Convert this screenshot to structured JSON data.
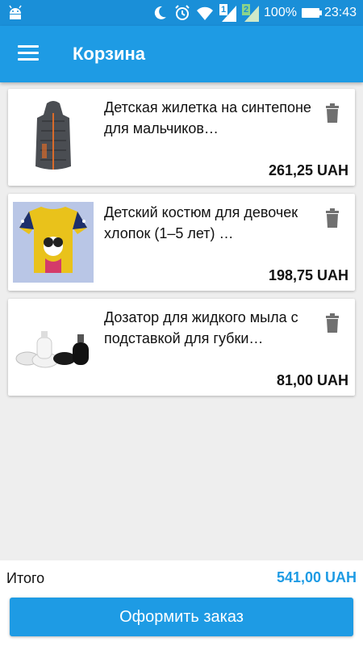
{
  "status_bar": {
    "battery": "100%",
    "time": "23:43",
    "sim1": "1",
    "sim2": "2"
  },
  "app_bar": {
    "title": "Корзина"
  },
  "cart": {
    "items": [
      {
        "name": "Детская жилетка на синтепоне для мальчиков…",
        "price": "261,25 UAH"
      },
      {
        "name": "Детский костюм для девочек хлопок (1–5 лет) …",
        "price": "198,75 UAH"
      },
      {
        "name": "Дозатор для жидкого мыла с подставкой для губки…",
        "price": "81,00 UAH"
      }
    ]
  },
  "footer": {
    "total_label": "Итого",
    "total_value": "541,00 UAH",
    "checkout_label": "Оформить заказ"
  },
  "colors": {
    "primary": "#1e9be4",
    "status_bar": "#1a8fd8",
    "background": "#eeeeee"
  }
}
